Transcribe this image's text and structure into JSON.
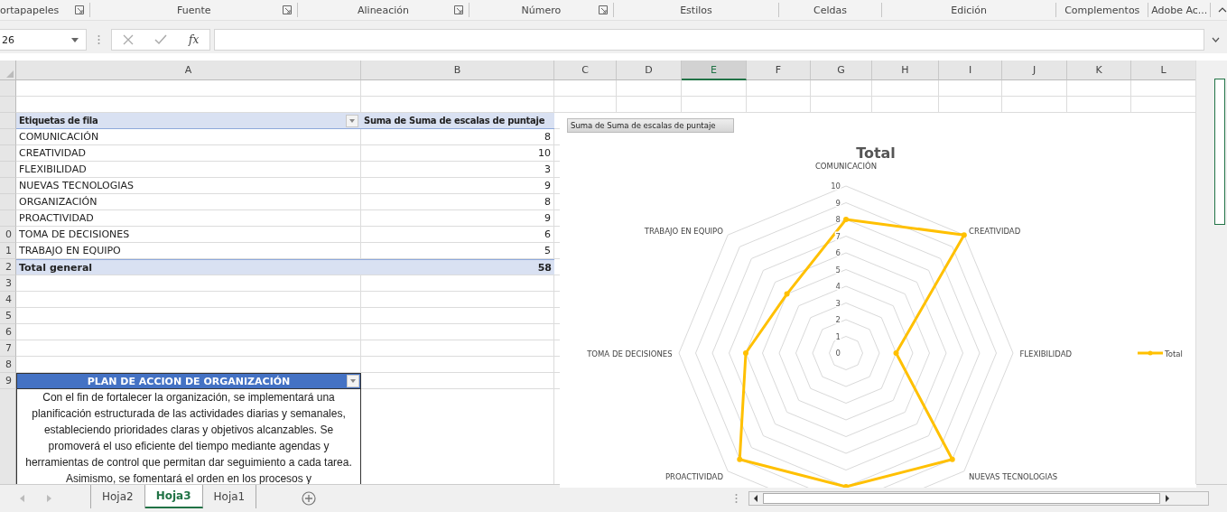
{
  "ribbon_groups": [
    {
      "label": "ortapapeles",
      "launcher": true
    },
    {
      "label": "Fuente",
      "launcher": true
    },
    {
      "label": "Alineación",
      "launcher": true
    },
    {
      "label": "Número",
      "launcher": true
    },
    {
      "label": "Estilos",
      "launcher": false
    },
    {
      "label": "Celdas",
      "launcher": false
    },
    {
      "label": "Edición",
      "launcher": false
    },
    {
      "label": "Complementos",
      "launcher": false
    },
    {
      "label": "Adobe Ac...",
      "launcher": false
    }
  ],
  "name_box": "26",
  "formula_fx": "fx",
  "column_headers": [
    {
      "label": "A",
      "selected": false
    },
    {
      "label": "B",
      "selected": false
    },
    {
      "label": "C",
      "selected": false
    },
    {
      "label": "D",
      "selected": false
    },
    {
      "label": "E",
      "selected": true
    },
    {
      "label": "F",
      "selected": false
    },
    {
      "label": "G",
      "selected": false
    },
    {
      "label": "H",
      "selected": false
    },
    {
      "label": "I",
      "selected": false
    },
    {
      "label": "J",
      "selected": false
    },
    {
      "label": "K",
      "selected": false
    },
    {
      "label": "L",
      "selected": false
    }
  ],
  "row_numbers": [
    "0",
    "1",
    "2",
    "3",
    "4",
    "5",
    "6",
    "7",
    "8",
    "9"
  ],
  "pivot": {
    "header": {
      "label": "Etiquetas de fila",
      "value": "Suma de Suma de escalas de puntaje"
    },
    "rows": [
      {
        "label": "COMUNICACIÓN",
        "value": "8"
      },
      {
        "label": "CREATIVIDAD",
        "value": "10"
      },
      {
        "label": "FLEXIBILIDAD",
        "value": "3"
      },
      {
        "label": "NUEVAS TECNOLOGIAS",
        "value": "9"
      },
      {
        "label": "ORGANIZACIÓN",
        "value": "8"
      },
      {
        "label": "PROACTIVIDAD",
        "value": "9"
      },
      {
        "label": "TOMA DE DECISIONES",
        "value": "6"
      },
      {
        "label": "TRABAJO EN EQUIPO",
        "value": "5"
      }
    ],
    "total": {
      "label": "Total general",
      "value": "58"
    }
  },
  "plan": {
    "title": "PLAN DE ACCION DE ORGANIZACIÓN",
    "text": "Con el fin de fortalecer la organización, se implementará una planificación estructurada de las actividades diarias y semanales, estableciendo prioridades claras y objetivos alcanzables. Se promoverá el uso eficiente del tiempo mediante agendas y herramientas de control que permitan dar seguimiento a cada tarea. Asimismo, se fomentará el orden en los procesos y"
  },
  "chart": {
    "field_button": "Suma de Suma de escalas de puntaje",
    "title": "Total",
    "axis_labels": [
      "COMUNICACIÓN",
      "TRABAJO EN EQUIPO",
      "CREATIVIDAD",
      "TOMA DE DECISIONES",
      "FLEXIBILIDAD",
      "PROACTIVIDAD",
      "NUEVAS TECNOLOGIAS"
    ],
    "tick_labels": [
      "10",
      "9",
      "8",
      "7",
      "6",
      "5",
      "4",
      "3",
      "2",
      "1",
      "0"
    ],
    "legend": {
      "label": "Total",
      "color": "#ffc000"
    }
  },
  "sheet_tabs": [
    {
      "label": "Hoja2",
      "selected": false
    },
    {
      "label": "Hoja3",
      "selected": true
    },
    {
      "label": "Hoja1",
      "selected": false
    }
  ]
}
